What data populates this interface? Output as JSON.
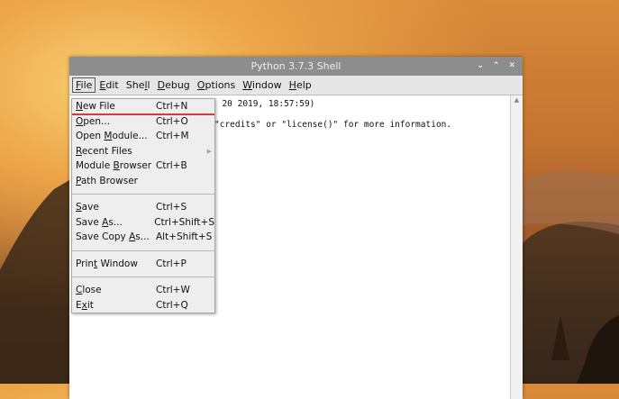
{
  "window": {
    "title": "Python 3.7.3 Shell",
    "controls": [
      "chevron-down-icon",
      "chevron-up-icon",
      "close-icon"
    ]
  },
  "menubar": {
    "items": [
      {
        "label": "File",
        "ul": "F"
      },
      {
        "label": "Edit",
        "ul": "E"
      },
      {
        "label": "Shell",
        "ul": "l"
      },
      {
        "label": "Debug",
        "ul": "D"
      },
      {
        "label": "Options",
        "ul": "O"
      },
      {
        "label": "Window",
        "ul": "W"
      },
      {
        "label": "Help",
        "ul": "H"
      }
    ]
  },
  "editor": {
    "line1": ": 20 2019, 18:57:59)",
    "line2": "\"credits\" or \"license()\" for more information."
  },
  "file_menu": {
    "items": [
      {
        "label": "New File",
        "accel": "Ctrl+N",
        "ul": 0
      },
      {
        "label": "Open...",
        "accel": "Ctrl+O",
        "ul": 0
      },
      {
        "label": "Open Module...",
        "accel": "Ctrl+M",
        "ul": 5
      },
      {
        "label": "Recent Files",
        "accel": "",
        "ul": 0,
        "submenu": true
      },
      {
        "label": "Module Browser",
        "accel": "Ctrl+B",
        "ul": 7
      },
      {
        "label": "Path Browser",
        "accel": "",
        "ul": 0
      },
      {
        "sep": true
      },
      {
        "label": "Save",
        "accel": "Ctrl+S",
        "ul": 0
      },
      {
        "label": "Save As...",
        "accel": "Ctrl+Shift+S",
        "ul": 5
      },
      {
        "label": "Save Copy As...",
        "accel": "Alt+Shift+S",
        "ul": 10
      },
      {
        "sep": true
      },
      {
        "label": "Print Window",
        "accel": "Ctrl+P",
        "ul": 4
      },
      {
        "sep": true
      },
      {
        "label": "Close",
        "accel": "Ctrl+W",
        "ul": 0
      },
      {
        "label": "Exit",
        "accel": "Ctrl+Q",
        "ul": 1
      }
    ]
  }
}
